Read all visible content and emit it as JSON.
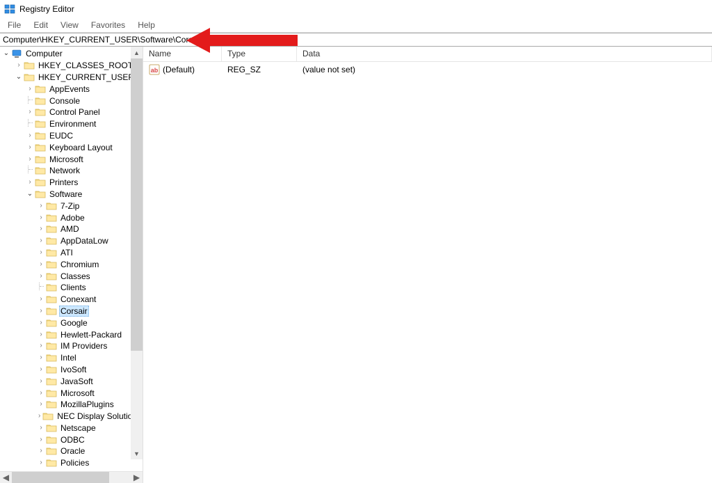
{
  "window": {
    "title": "Registry Editor"
  },
  "menu": {
    "file": "File",
    "edit": "Edit",
    "view": "View",
    "favorites": "Favorites",
    "help": "Help"
  },
  "address": {
    "value": "Computer\\HKEY_CURRENT_USER\\Software\\Corsair"
  },
  "tree": {
    "root": "Computer",
    "items": [
      {
        "label": "HKEY_CLASSES_ROOT",
        "depth": 1,
        "expand": "closed"
      },
      {
        "label": "HKEY_CURRENT_USER",
        "depth": 1,
        "expand": "open"
      },
      {
        "label": "AppEvents",
        "depth": 2,
        "expand": "closed"
      },
      {
        "label": "Console",
        "depth": 2,
        "expand": "none"
      },
      {
        "label": "Control Panel",
        "depth": 2,
        "expand": "closed"
      },
      {
        "label": "Environment",
        "depth": 2,
        "expand": "none"
      },
      {
        "label": "EUDC",
        "depth": 2,
        "expand": "closed"
      },
      {
        "label": "Keyboard Layout",
        "depth": 2,
        "expand": "closed"
      },
      {
        "label": "Microsoft",
        "depth": 2,
        "expand": "closed"
      },
      {
        "label": "Network",
        "depth": 2,
        "expand": "none"
      },
      {
        "label": "Printers",
        "depth": 2,
        "expand": "closed"
      },
      {
        "label": "Software",
        "depth": 2,
        "expand": "open"
      },
      {
        "label": "7-Zip",
        "depth": 3,
        "expand": "closed"
      },
      {
        "label": "Adobe",
        "depth": 3,
        "expand": "closed"
      },
      {
        "label": "AMD",
        "depth": 3,
        "expand": "closed"
      },
      {
        "label": "AppDataLow",
        "depth": 3,
        "expand": "closed"
      },
      {
        "label": "ATI",
        "depth": 3,
        "expand": "closed"
      },
      {
        "label": "Chromium",
        "depth": 3,
        "expand": "closed"
      },
      {
        "label": "Classes",
        "depth": 3,
        "expand": "closed"
      },
      {
        "label": "Clients",
        "depth": 3,
        "expand": "none"
      },
      {
        "label": "Conexant",
        "depth": 3,
        "expand": "closed"
      },
      {
        "label": "Corsair",
        "depth": 3,
        "expand": "closed",
        "selected": true
      },
      {
        "label": "Google",
        "depth": 3,
        "expand": "closed"
      },
      {
        "label": "Hewlett-Packard",
        "depth": 3,
        "expand": "closed"
      },
      {
        "label": "IM Providers",
        "depth": 3,
        "expand": "closed"
      },
      {
        "label": "Intel",
        "depth": 3,
        "expand": "closed"
      },
      {
        "label": "IvoSoft",
        "depth": 3,
        "expand": "closed"
      },
      {
        "label": "JavaSoft",
        "depth": 3,
        "expand": "closed"
      },
      {
        "label": "Microsoft",
        "depth": 3,
        "expand": "closed"
      },
      {
        "label": "MozillaPlugins",
        "depth": 3,
        "expand": "closed"
      },
      {
        "label": "NEC Display Solutions",
        "depth": 3,
        "expand": "closed"
      },
      {
        "label": "Netscape",
        "depth": 3,
        "expand": "closed"
      },
      {
        "label": "ODBC",
        "depth": 3,
        "expand": "closed"
      },
      {
        "label": "Oracle",
        "depth": 3,
        "expand": "closed"
      },
      {
        "label": "Policies",
        "depth": 3,
        "expand": "closed"
      }
    ]
  },
  "list": {
    "headers": {
      "name": "Name",
      "type": "Type",
      "data": "Data"
    },
    "rows": [
      {
        "name": "(Default)",
        "type": "REG_SZ",
        "data": "(value not set)"
      }
    ]
  }
}
